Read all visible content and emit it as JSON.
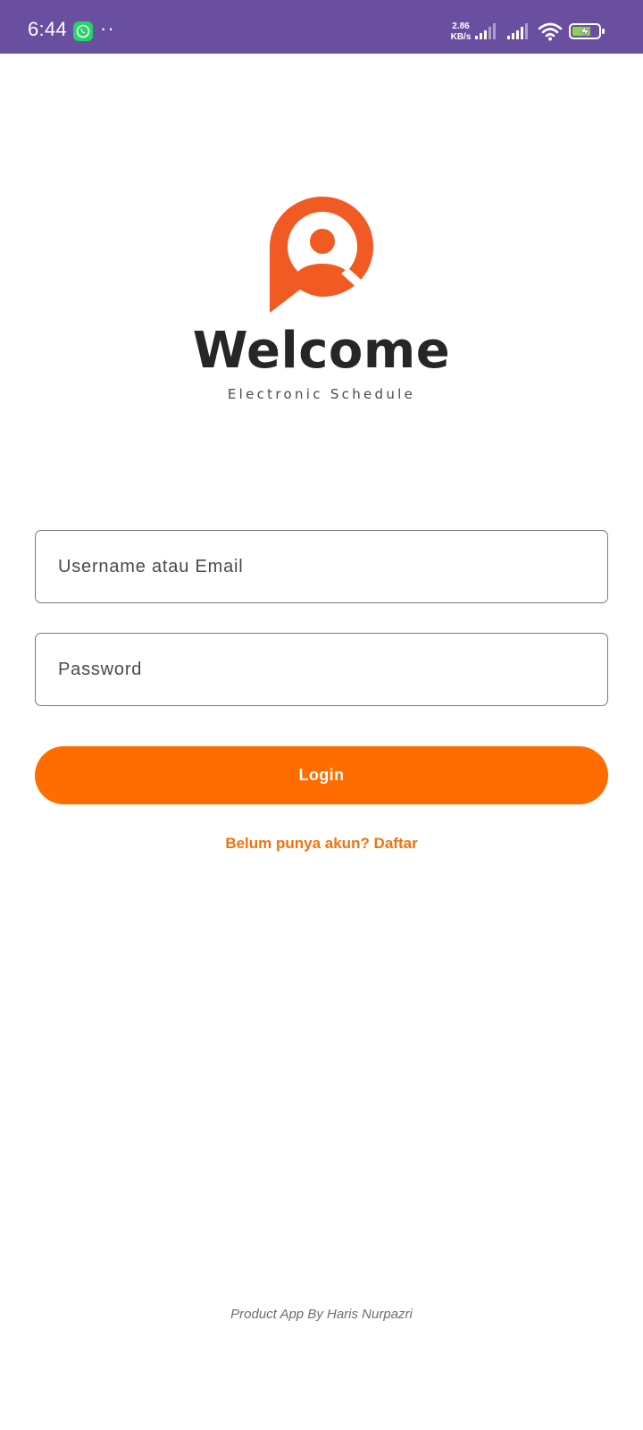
{
  "status_bar": {
    "time": "6:44",
    "dots": "··",
    "net_speed_value": "2.86",
    "net_speed_unit": "KB/s",
    "icons": [
      "whatsapp-icon",
      "signal-icon",
      "signal-icon",
      "wifi-icon",
      "battery-charging-icon"
    ],
    "background": "#6a4fa0"
  },
  "branding": {
    "title": "Welcome",
    "subtitle": "Electronic Schedule",
    "logo_icon": "user-location-pin-icon",
    "logo_color": "#f15a22"
  },
  "form": {
    "username_placeholder": "Username atau Email",
    "password_placeholder": "Password",
    "login_label": "Login",
    "register_text": "Belum punya akun? Daftar",
    "accent_color": "#ff6d00"
  },
  "footer": {
    "credit": "Product App By Haris Nurpazri"
  }
}
